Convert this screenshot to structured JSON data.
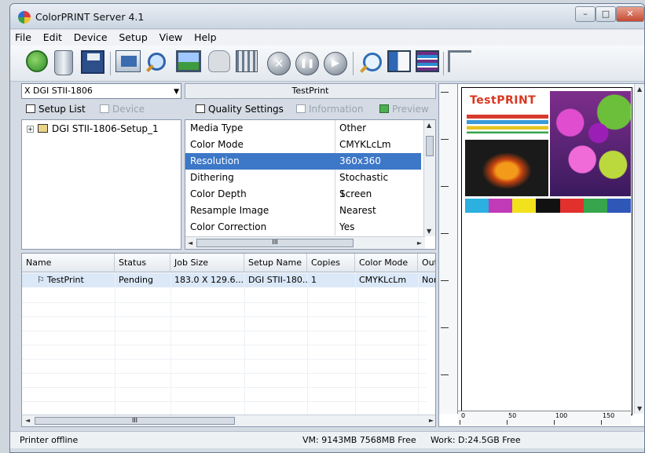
{
  "window": {
    "title": "ColorPRINT Server 4.1",
    "controls": {
      "minimize": "–",
      "maximize": "□",
      "close": "✕"
    }
  },
  "menu": [
    "File",
    "Edit",
    "Device",
    "Setup",
    "View",
    "Help"
  ],
  "toolbar": {
    "icons": [
      "refresh-icon",
      "trash-icon",
      "save-icon",
      "setup-icon",
      "magnify-icon",
      "image-icon",
      "hand-icon",
      "grid-icon",
      "stop-icon",
      "pause-icon",
      "play-icon",
      "find-icon",
      "layout-icon",
      "data-icon",
      "rotate-icon"
    ],
    "stop_glyph": "✕",
    "pause_glyph": "❚❚",
    "play_glyph": "▶"
  },
  "setup_select": {
    "value": "X DGI STII-1806",
    "arrow": "▼"
  },
  "printer_name": "TestPrint",
  "left_tabs": {
    "setup_list": "Setup List",
    "device": "Device"
  },
  "right_tabs": {
    "quality": "Quality Settings",
    "information": "Information",
    "preview": "Preview"
  },
  "tree": {
    "expander": "+",
    "item": "DGI STII-1806-Setup_1"
  },
  "properties": [
    {
      "key": "Media Type",
      "value": "Other"
    },
    {
      "key": "Color Mode",
      "value": "CMYKLcLm"
    },
    {
      "key": "Resolution",
      "value": "360x360",
      "selected": true
    },
    {
      "key": "Dithering",
      "value": "Stochastic Screen"
    },
    {
      "key": "Color Depth",
      "value": "1"
    },
    {
      "key": "Resample Image",
      "value": "Nearest"
    },
    {
      "key": "Color Correction",
      "value": "Yes"
    }
  ],
  "jobs": {
    "columns": [
      "Name",
      "Status",
      "Job Size",
      "Setup Name",
      "Copies",
      "Color Mode",
      "Outp"
    ],
    "rows": [
      [
        "TestPrint",
        "Pending",
        "183.0 X 129.6...",
        "DGI STII-180...",
        "1",
        "CMYKLcLm",
        "None"
      ]
    ]
  },
  "preview": {
    "logo": "TestPRINT",
    "swatches": [
      "#2bb0e0",
      "#c13ab8",
      "#f2e21c",
      "#111111",
      "#e2302d",
      "#37a54c",
      "#2f57b8"
    ],
    "ruler_labels": [
      "0",
      "50",
      "100",
      "150"
    ]
  },
  "status": {
    "printer": "Printer offline",
    "vm": "VM: 9143MB 7568MB Free",
    "work": "Work: D:24.5GB Free"
  },
  "scroll_glyphs": {
    "up": "▲",
    "down": "▼",
    "left": "◄",
    "right": "►",
    "grip": "III"
  }
}
